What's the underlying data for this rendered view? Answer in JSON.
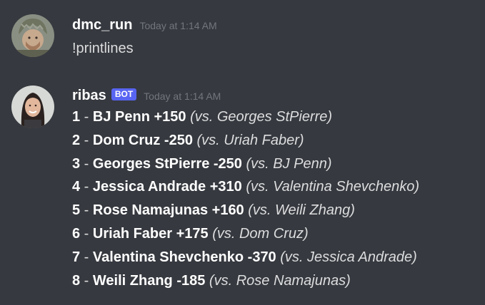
{
  "messages": [
    {
      "author": "dmc_run",
      "timestamp": "Today at 1:14 AM",
      "text": "!printlines",
      "avatar": "user-avatar"
    },
    {
      "author": "ribas",
      "bot_tag": "BOT",
      "timestamp": "Today at 1:14 AM",
      "avatar": "bot-avatar",
      "lines": [
        {
          "num": "1",
          "sep": " - ",
          "pick": "BJ Penn +150",
          "vs": "(vs. Georges StPierre)"
        },
        {
          "num": "2",
          "sep": " - ",
          "pick": "Dom Cruz -250",
          "vs": "(vs. Uriah Faber)"
        },
        {
          "num": "3",
          "sep": " - ",
          "pick": "Georges StPierre -250",
          "vs": "(vs. BJ Penn)"
        },
        {
          "num": "4",
          "sep": " - ",
          "pick": "Jessica Andrade +310",
          "vs": "(vs. Valentina Shevchenko)"
        },
        {
          "num": "5",
          "sep": " - ",
          "pick": "Rose Namajunas +160",
          "vs": "(vs. Weili Zhang)"
        },
        {
          "num": "6",
          "sep": " - ",
          "pick": "Uriah Faber +175",
          "vs": "(vs. Dom Cruz)"
        },
        {
          "num": "7",
          "sep": " - ",
          "pick": "Valentina Shevchenko -370",
          "vs": "(vs. Jessica Andrade)"
        },
        {
          "num": "8",
          "sep": " - ",
          "pick": "Weili Zhang -185",
          "vs": "(vs. Rose Namajunas)"
        }
      ]
    }
  ],
  "colors": {
    "background": "#36393f",
    "username": "#ffffff",
    "timestamp": "#72767d",
    "text": "#dcddde",
    "bot_tag": "#5865f2"
  }
}
